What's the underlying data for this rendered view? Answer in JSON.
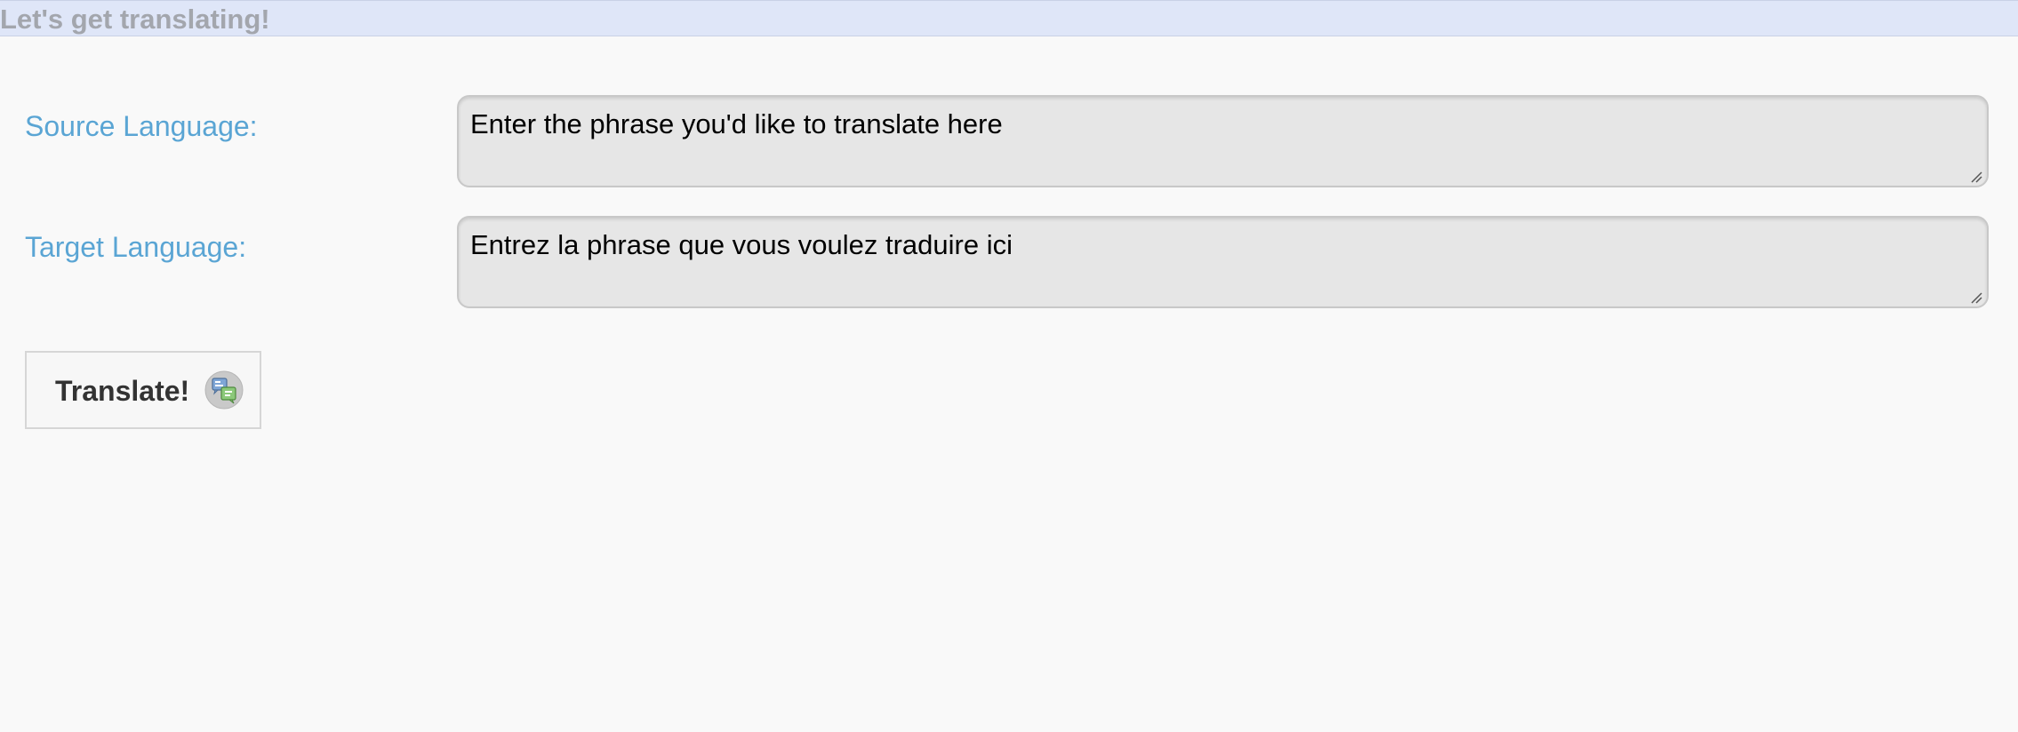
{
  "header": {
    "title": "Let's get translating!"
  },
  "form": {
    "source": {
      "label": "Source Language:",
      "placeholder": "Enter the phrase you'd like to translate here",
      "value": ""
    },
    "target": {
      "label": "Target Language:",
      "placeholder": "Entrez la phrase que vous voulez traduire ici",
      "value": ""
    },
    "translate_button": {
      "label": "Translate!",
      "icon": "translate-icon"
    }
  },
  "colors": {
    "header_background": "#dfe6f8",
    "header_text": "#a3a6ad",
    "label_text": "#5aa5d4",
    "field_background": "#e6e6e6",
    "page_background": "#f9f9f9"
  }
}
